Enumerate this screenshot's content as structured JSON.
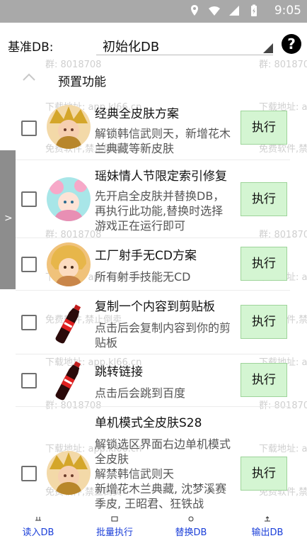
{
  "status_bar": {
    "time": "9:05",
    "icons": [
      "location-icon",
      "wifi-icon",
      "signal-icon",
      "battery-icon"
    ]
  },
  "header": {
    "db_label": "基准DB:",
    "db_value": "初始化DB",
    "help": "?"
  },
  "section": {
    "title": "预置功能"
  },
  "side_handle": {
    "label": ">"
  },
  "watermarks": [
    "群: 8018708",
    "群: 801870",
    "下载地址: app.kl66.cn",
    "下载地址: a",
    "免费软件,禁止倒卖",
    "免费软件,禁"
  ],
  "items": [
    {
      "title": "经典全皮肤方案",
      "desc": "解锁韩信武则天，新增花木兰典藏等新皮肤",
      "action": "执行",
      "icon": "hero-avatar-icon"
    },
    {
      "title": "瑶妹情人节限定索引修复",
      "desc": "先开启全皮肤并替换DB，再执行此功能,替换时选择游戏正在运行即可",
      "action": "执行",
      "icon": "yao-avatar-icon"
    },
    {
      "title": "工厂射手无CD方案",
      "desc": "所有射手技能无CD",
      "action": "执行",
      "icon": "marksman-avatar-icon"
    },
    {
      "title": "复制一个内容到剪贴板",
      "desc": "点击后会复制内容到你的剪贴板",
      "action": "执行",
      "icon": "cola-bottle-icon"
    },
    {
      "title": "跳转链接",
      "desc": "点击后会跳到百度",
      "action": "执行",
      "icon": "cola-bottle-icon"
    },
    {
      "title": "单机模式全皮肤S28",
      "desc": "解锁选区界面右边单机模式全皮肤\n解禁韩信武则天\n新增花木兰典藏, 沈梦溪赛季皮, 王昭君、狂铁战",
      "action": "执行",
      "icon": "hero-avatar-icon"
    }
  ],
  "bottom_nav": [
    {
      "label": "读入DB",
      "icon": "import-icon"
    },
    {
      "label": "批量执行",
      "icon": "batch-icon"
    },
    {
      "label": "替换DB",
      "icon": "replace-icon"
    },
    {
      "label": "输出DB",
      "icon": "export-icon"
    }
  ],
  "colors": {
    "exec_bg": "#d4f5d2",
    "nav_text": "#1b3fd9",
    "status_bar": "#a9a9a9"
  }
}
